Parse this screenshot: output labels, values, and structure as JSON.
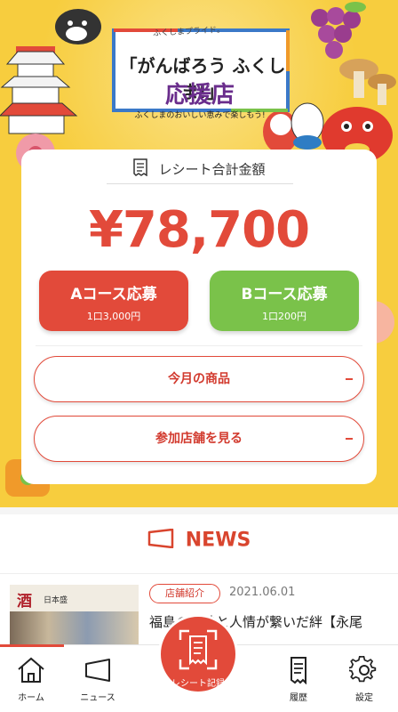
{
  "hero": {
    "banner_sub": "ふくしまプライド。",
    "banner_title": "「がんばろう ふくしま!」",
    "banner_shop": "応援店",
    "banner_tagline": "ふくしまのおいしい恵みで楽しもう!"
  },
  "receipt": {
    "label": "レシート合計金額",
    "amount": "¥78,700",
    "course_a": {
      "label": "Aコース応募",
      "sub": "1口3,000円"
    },
    "course_b": {
      "label": "Bコース応募",
      "sub": "1口200円"
    },
    "monthly_products": "今月の商品",
    "participating_stores": "参加店舗を見る"
  },
  "news": {
    "heading": "NEWS",
    "item": {
      "category": "店舗紹介",
      "date": "2021.06.01",
      "headline": "福島の情熱と人情が繋いだ絆【永尾",
      "thumb_sign": "酒",
      "thumb_shop": "日本盛"
    }
  },
  "tabbar": {
    "home": "ホーム",
    "news": "ニュース",
    "record": "レシート記録",
    "history": "履歴",
    "settings": "設定"
  },
  "colors": {
    "accent": "#e24a3a",
    "course_b": "#7ac24a",
    "hero_bg": "#f7cd3e"
  }
}
